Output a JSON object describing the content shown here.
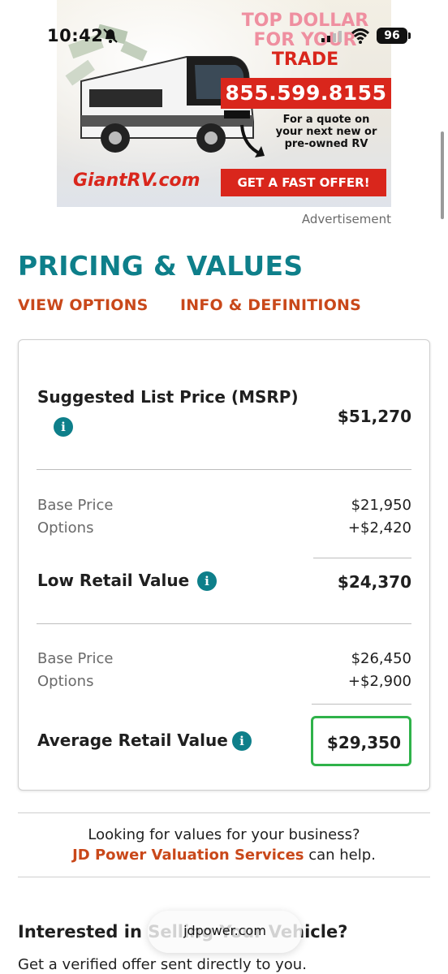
{
  "status_bar": {
    "time": "10:42",
    "battery": "96",
    "icons": [
      "bell-muted-icon",
      "signal-icon",
      "wifi-icon",
      "battery-icon"
    ]
  },
  "ad": {
    "headline_line1": "TOP DOLLAR",
    "headline_line2": "FOR YOUR",
    "headline_line3": "TRADE",
    "phone": "855.599.8155",
    "quote": "For a quote on your next new or pre-owned RV",
    "site": "GiantRV.com",
    "cta": "GET A FAST OFFER!",
    "label": "Advertisement"
  },
  "pricing": {
    "title": "PRICING & VALUES",
    "tabs": {
      "view_options": "VIEW OPTIONS",
      "info_definitions": "INFO & DEFINITIONS"
    },
    "msrp": {
      "label": "Suggested List Price (MSRP)",
      "value": "$51,270"
    },
    "low": {
      "base_label": "Base Price",
      "base_value": "$21,950",
      "options_label": "Options",
      "options_value": "+$2,420",
      "label": "Low Retail Value",
      "value": "$24,370"
    },
    "average": {
      "base_label": "Base Price",
      "base_value": "$26,450",
      "options_label": "Options",
      "options_value": "+$2,900",
      "label": "Average Retail Value",
      "value": "$29,350"
    }
  },
  "business": {
    "line1": "Looking for values for your business?",
    "link": "JD Power Valuation Services",
    "suffix": " can help."
  },
  "interested": {
    "heading": "Interested in Selling Your Vehicle?",
    "sub": "Get a verified offer sent directly to you."
  },
  "browser": {
    "url": "jdpower.com"
  },
  "colors": {
    "teal": "#0e7f8a",
    "orange": "#c9481a",
    "highlight_green": "#2fb24a",
    "ad_red": "#d9261c"
  }
}
